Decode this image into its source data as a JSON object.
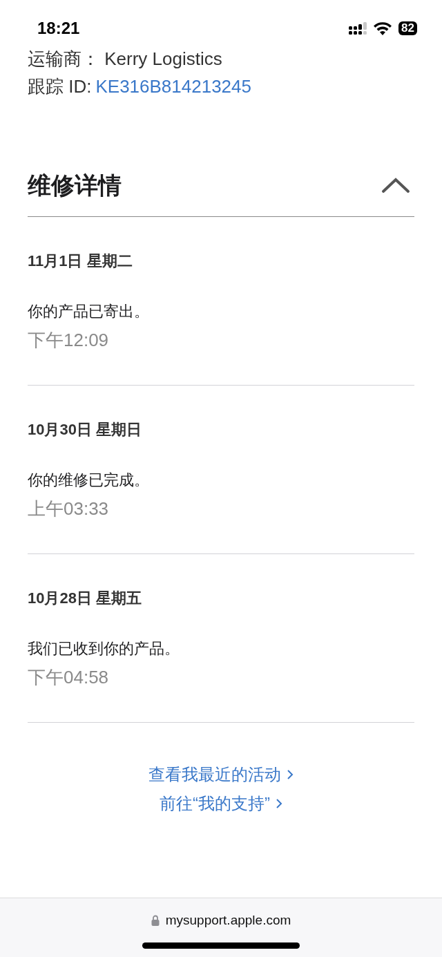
{
  "status_bar": {
    "time": "18:21",
    "battery": "82"
  },
  "shipping": {
    "carrier_label": "运输商：",
    "carrier": "Kerry Logistics",
    "tracking_label": "跟踪 ID:",
    "tracking_id": "KE316B814213245"
  },
  "repair_details": {
    "title": "维修详情",
    "expanded": true,
    "events": [
      {
        "date": "11月1日 星期二",
        "message": "你的产品已寄出。",
        "time": "下午12:09"
      },
      {
        "date": "10月30日 星期日",
        "message": "你的维修已完成。",
        "time": "上午03:33"
      },
      {
        "date": "10月28日 星期五",
        "message": "我们已收到你的产品。",
        "time": "下午04:58"
      }
    ]
  },
  "links": [
    "查看我最近的活动",
    "前往“我的支持”"
  ],
  "address_bar": {
    "url": "mysupport.apple.com"
  }
}
